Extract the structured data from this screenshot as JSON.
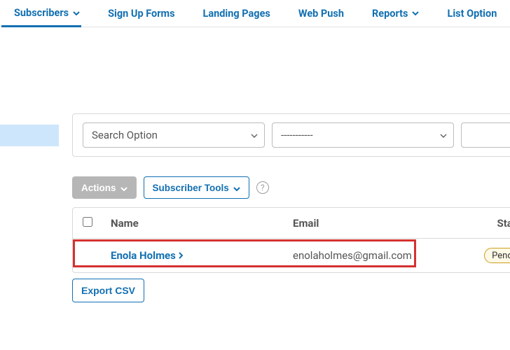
{
  "nav": {
    "subscribers": "Subscribers",
    "signup": "Sign Up Forms",
    "landing": "Landing Pages",
    "webpush": "Web Push",
    "reports": "Reports",
    "listoptions": "List Option"
  },
  "filters": {
    "search_option": "Search Option",
    "dashes": "-----------"
  },
  "toolbar": {
    "actions": "Actions",
    "tools": "Subscriber Tools"
  },
  "table": {
    "headers": {
      "name": "Name",
      "email": "Email",
      "status": "Status"
    },
    "row": {
      "name": "Enola Holmes",
      "email": "enolaholmes@gmail.com",
      "status": "Pendin"
    }
  },
  "export": "Export CSV",
  "help": "?"
}
